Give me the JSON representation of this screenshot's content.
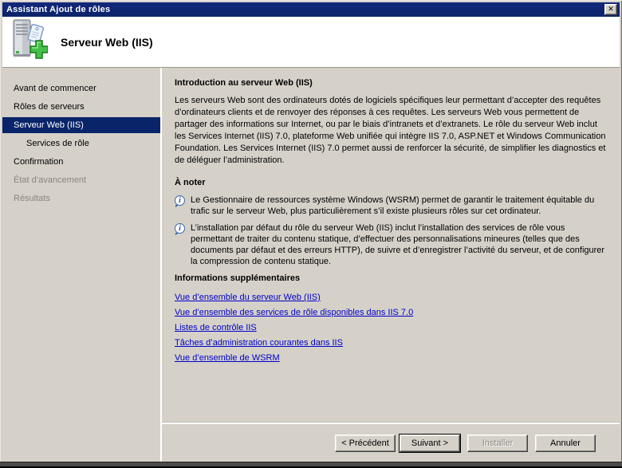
{
  "window": {
    "title": "Assistant Ajout de rôles",
    "close_label": "✕"
  },
  "header": {
    "title": "Serveur Web (IIS)",
    "icon": "server-add-icon"
  },
  "sidebar": {
    "items": [
      {
        "label": "Avant de commencer",
        "state": "enabled",
        "indent": false
      },
      {
        "label": "Rôles de serveurs",
        "state": "enabled",
        "indent": false
      },
      {
        "label": "Serveur Web (IIS)",
        "state": "selected",
        "indent": false
      },
      {
        "label": "Services de rôle",
        "state": "enabled",
        "indent": true
      },
      {
        "label": "Confirmation",
        "state": "enabled",
        "indent": false
      },
      {
        "label": "État d’avancement",
        "state": "disabled",
        "indent": false
      },
      {
        "label": "Résultats",
        "state": "disabled",
        "indent": false
      }
    ]
  },
  "content": {
    "intro_heading": "Introduction au serveur Web (IIS)",
    "intro_text": "Les serveurs Web sont des ordinateurs dotés de logiciels spécifiques leur permettant d’accepter des requêtes d’ordinateurs clients et de renvoyer des réponses à ces requêtes. Les serveurs Web vous permettent de partager des informations sur Internet, ou par le biais d’intranets et d’extranets. Le rôle du serveur Web inclut les Services Internet (IIS) 7.0, plateforme Web unifiée qui intègre IIS 7.0, ASP.NET et Windows Communication Foundation. Les Services Internet (IIS) 7.0 permet aussi de renforcer la sécurité, de simplifier les diagnostics et de déléguer l’administration.",
    "notes_heading": "À noter",
    "note_icon": "info-balloon-icon",
    "notes": [
      {
        "text": "Le Gestionnaire de ressources système Windows (WSRM) permet de garantir le traitement équitable du trafic sur le serveur Web, plus particulièrement s’il existe plusieurs rôles sur cet ordinateur."
      },
      {
        "text": "L’installation par défaut du rôle du serveur Web (IIS) inclut l’installation des services de rôle vous permettant de traiter du contenu statique, d’effectuer des personnalisations mineures (telles que des documents par défaut et des erreurs HTTP), de suivre et d’enregistrer l’activité du serveur, et de configurer la compression de contenu statique."
      }
    ],
    "links_heading": "Informations supplémentaires",
    "links": [
      "Vue d’ensemble du serveur Web (IIS)",
      "Vue d’ensemble des services de rôle disponibles dans IIS 7.0",
      "Listes de contrôle IIS",
      "Tâches d’administration courantes dans IIS",
      "Vue d’ensemble de WSRM"
    ]
  },
  "buttons": {
    "back": "< Précédent",
    "next": "Suivant >",
    "install": "Installer",
    "cancel": "Annuler"
  },
  "colors": {
    "titlebar_blue": "#0A246A",
    "selected_nav_blue": "#0A246A",
    "window_gray": "#D5D1C9",
    "link_blue": "#0000CC",
    "plus_green": "#44C04A",
    "disabled_text": "#8A867E"
  }
}
